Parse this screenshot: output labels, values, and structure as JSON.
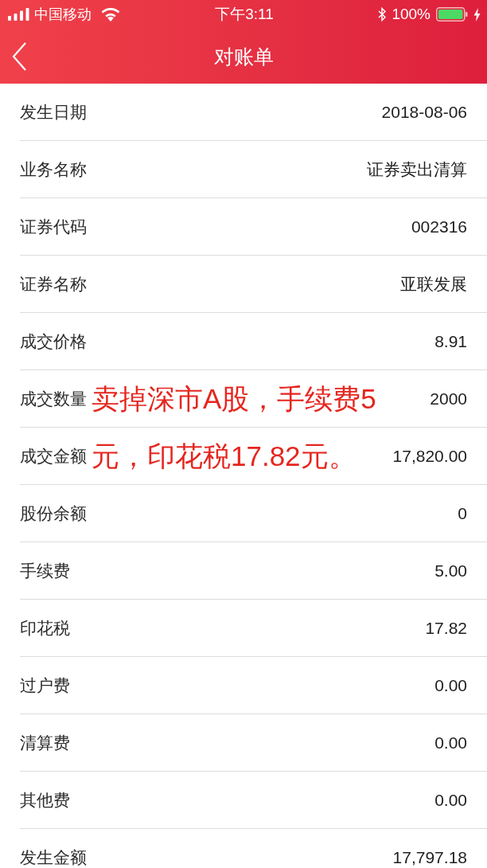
{
  "status_bar": {
    "carrier": "中国移动",
    "time": "下午3:11",
    "battery": "100%"
  },
  "nav_bar": {
    "title": "对账单"
  },
  "rows": [
    {
      "label": "发生日期",
      "value": "2018-08-06"
    },
    {
      "label": "业务名称",
      "value": "证券卖出清算"
    },
    {
      "label": "证券代码",
      "value": "002316"
    },
    {
      "label": "证券名称",
      "value": "亚联发展"
    },
    {
      "label": "成交价格",
      "value": "8.91"
    },
    {
      "label": "成交数量",
      "value": "2000"
    },
    {
      "label": "成交金额",
      "value": "17,820.00"
    },
    {
      "label": "股份余额",
      "value": "0"
    },
    {
      "label": "手续费",
      "value": "5.00"
    },
    {
      "label": "印花税",
      "value": "17.82"
    },
    {
      "label": "过户费",
      "value": "0.00"
    },
    {
      "label": "清算费",
      "value": "0.00"
    },
    {
      "label": "其他费",
      "value": "0.00"
    },
    {
      "label": "发生金额",
      "value": "17,797.18"
    }
  ],
  "annotation": {
    "text": "卖掉深市A股，手续费5元，印花税17.82元。"
  }
}
